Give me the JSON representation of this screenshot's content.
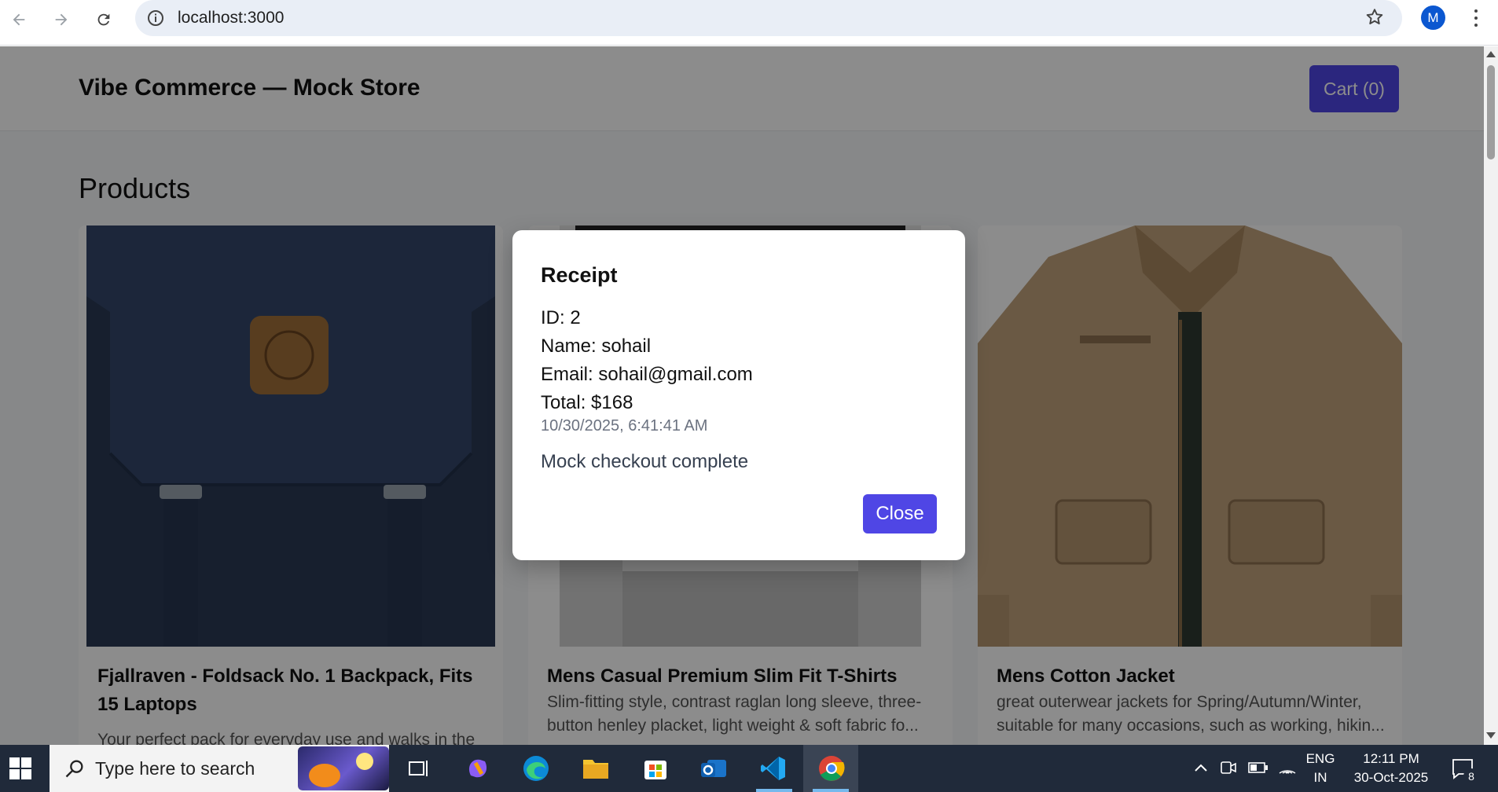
{
  "browser": {
    "url": "localhost:3000",
    "profile_initial": "M"
  },
  "header": {
    "store_title": "Vibe Commerce — Mock Store",
    "cart_label": "Cart (0)"
  },
  "main": {
    "section_title": "Products",
    "products": [
      {
        "name": "Fjallraven - Foldsack No. 1 Backpack, Fits 15 Laptops",
        "description": "Your perfect pack for everyday use and walks in the",
        "image_icon": "backpack-image"
      },
      {
        "name": "Mens Casual Premium Slim Fit T-Shirts",
        "description": "Slim-fitting style, contrast raglan long sleeve, three-button henley placket, light weight & soft fabric fo...",
        "image_icon": "tshirt-image"
      },
      {
        "name": "Mens Cotton Jacket",
        "description": "great outerwear jackets for Spring/Autumn/Winter, suitable for many occasions, such as working, hikin...",
        "image_icon": "jacket-image"
      }
    ]
  },
  "receipt_modal": {
    "title": "Receipt",
    "id_line": "ID: 2",
    "name_line": "Name: sohail",
    "email_line": "Email: sohail@gmail.com",
    "total_line": "Total: $168",
    "timestamp": "10/30/2025, 6:41:41 AM",
    "message": "Mock checkout complete",
    "close_label": "Close"
  },
  "taskbar": {
    "search_placeholder": "Type here to search",
    "language_top": "ENG",
    "language_bottom": "IN",
    "time": "12:11 PM",
    "date": "30-Oct-2025",
    "notification_count": "8"
  },
  "colors": {
    "accent": "#4f46e5",
    "overlay": "rgba(0,0,0,0.45)",
    "taskbar": "#202a3a"
  }
}
